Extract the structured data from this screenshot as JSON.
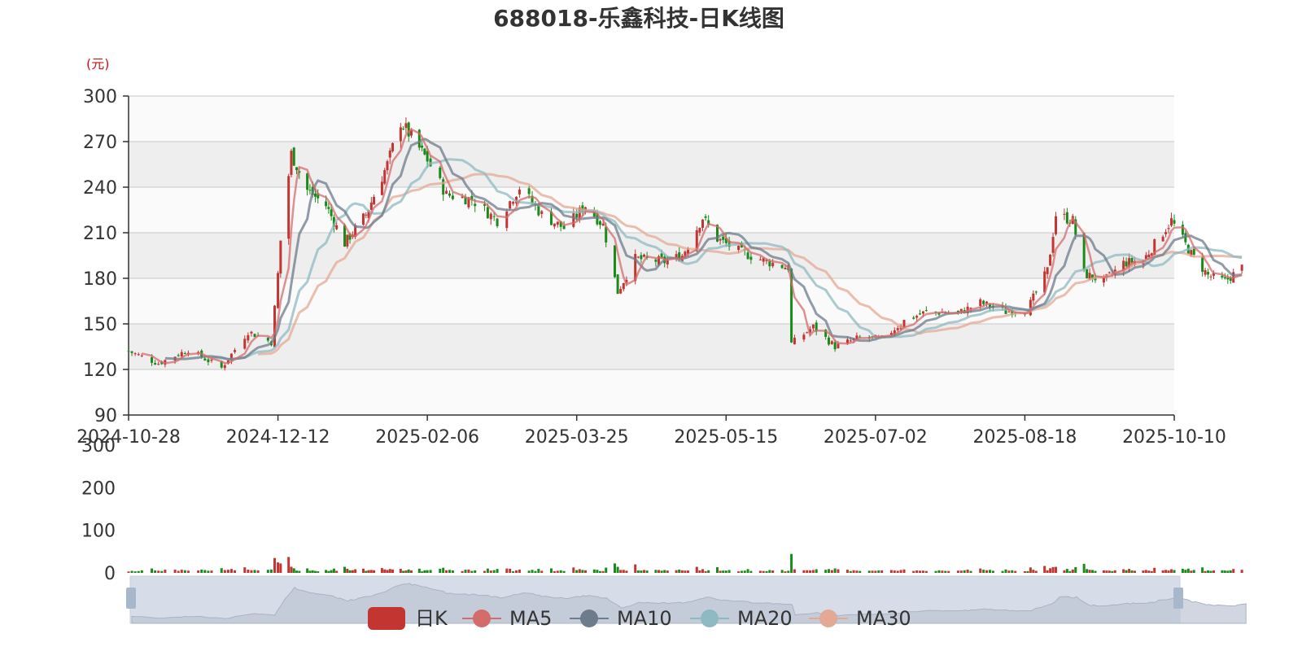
{
  "chart_data": {
    "type": "candlestick",
    "title": "688018-乐鑫科技-日K线图",
    "price_unit": "(元)",
    "ylim": [
      90,
      300
    ],
    "yticks": [
      "300",
      "270",
      "240",
      "210",
      "180",
      "150",
      "120",
      "90"
    ],
    "volume_yticks": [
      "300",
      "200",
      "100",
      "0"
    ],
    "volume_ylim": [
      0,
      300
    ],
    "xticks": [
      "2024-10-28",
      "2024-12-12",
      "2025-02-06",
      "2025-03-25",
      "2025-05-15",
      "2025-07-02",
      "2025-08-18",
      "2025-10-10"
    ],
    "legend": [
      "日K",
      "MA5",
      "MA10",
      "MA20",
      "MA30"
    ],
    "colors": {
      "up": "#c23531",
      "down": "#1a8a1a",
      "MA5": "#d46b6b",
      "MA10": "#6e7b8b",
      "MA20": "#8fb9c2",
      "MA30": "#e4a994",
      "grid_band": "#eeeeee"
    },
    "close_path": [
      {
        "date": "2024-10-28",
        "close": 132
      },
      {
        "date": "2024-11-06",
        "close": 124
      },
      {
        "date": "2024-11-15",
        "close": 133
      },
      {
        "date": "2024-11-25",
        "close": 121
      },
      {
        "date": "2024-12-03",
        "close": 145
      },
      {
        "date": "2024-12-10",
        "close": 138
      },
      {
        "date": "2024-12-13",
        "close": 205
      },
      {
        "date": "2024-12-17",
        "close": 262
      },
      {
        "date": "2024-12-23",
        "close": 238
      },
      {
        "date": "2024-12-30",
        "close": 228
      },
      {
        "date": "2025-01-06",
        "close": 203
      },
      {
        "date": "2025-01-14",
        "close": 222
      },
      {
        "date": "2025-01-22",
        "close": 255
      },
      {
        "date": "2025-01-27",
        "close": 283
      },
      {
        "date": "2025-02-06",
        "close": 258
      },
      {
        "date": "2025-02-12",
        "close": 235
      },
      {
        "date": "2025-02-20",
        "close": 232
      },
      {
        "date": "2025-02-28",
        "close": 218
      },
      {
        "date": "2025-03-07",
        "close": 240
      },
      {
        "date": "2025-03-14",
        "close": 222
      },
      {
        "date": "2025-03-21",
        "close": 213
      },
      {
        "date": "2025-03-28",
        "close": 228
      },
      {
        "date": "2025-04-03",
        "close": 215
      },
      {
        "date": "2025-04-08",
        "close": 171
      },
      {
        "date": "2025-04-14",
        "close": 193
      },
      {
        "date": "2025-04-24",
        "close": 191
      },
      {
        "date": "2025-04-30",
        "close": 195
      },
      {
        "date": "2025-05-07",
        "close": 220
      },
      {
        "date": "2025-05-12",
        "close": 206
      },
      {
        "date": "2025-05-20",
        "close": 197
      },
      {
        "date": "2025-05-28",
        "close": 191
      },
      {
        "date": "2025-06-04",
        "close": 187
      },
      {
        "date": "2025-06-05",
        "close": 137
      },
      {
        "date": "2025-06-12",
        "close": 148
      },
      {
        "date": "2025-06-19",
        "close": 135
      },
      {
        "date": "2025-06-27",
        "close": 141
      },
      {
        "date": "2025-07-04",
        "close": 140
      },
      {
        "date": "2025-07-11",
        "close": 152
      },
      {
        "date": "2025-07-18",
        "close": 158
      },
      {
        "date": "2025-07-28",
        "close": 157
      },
      {
        "date": "2025-08-04",
        "close": 164
      },
      {
        "date": "2025-08-12",
        "close": 158
      },
      {
        "date": "2025-08-19",
        "close": 160
      },
      {
        "date": "2025-08-26",
        "close": 185
      },
      {
        "date": "2025-08-29",
        "close": 222
      },
      {
        "date": "2025-09-04",
        "close": 218
      },
      {
        "date": "2025-09-08",
        "close": 183
      },
      {
        "date": "2025-09-15",
        "close": 178
      },
      {
        "date": "2025-09-22",
        "close": 190
      },
      {
        "date": "2025-09-29",
        "close": 192
      },
      {
        "date": "2025-10-09",
        "close": 218
      },
      {
        "date": "2025-10-16",
        "close": 196
      },
      {
        "date": "2025-10-22",
        "close": 182
      },
      {
        "date": "2025-10-28",
        "close": 178
      },
      {
        "date": "2025-11-03",
        "close": 187
      }
    ]
  }
}
